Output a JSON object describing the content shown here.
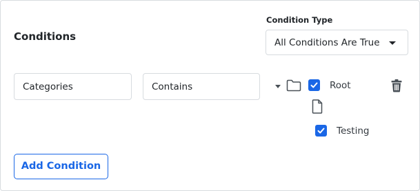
{
  "conditions": {
    "heading": "Conditions",
    "condition_type": {
      "label": "Condition Type",
      "selected": "All Conditions Are True"
    },
    "row": {
      "field": "Categories",
      "operator": "Contains"
    },
    "tree": {
      "root": {
        "label": "Root",
        "checked": true,
        "expanded": true
      },
      "children": [
        {
          "label": "Testing",
          "checked": true
        }
      ]
    },
    "add_button": "Add Condition"
  },
  "colors": {
    "accent": "#1a67e6",
    "border": "#d7dbdf",
    "icon": "#495057"
  }
}
